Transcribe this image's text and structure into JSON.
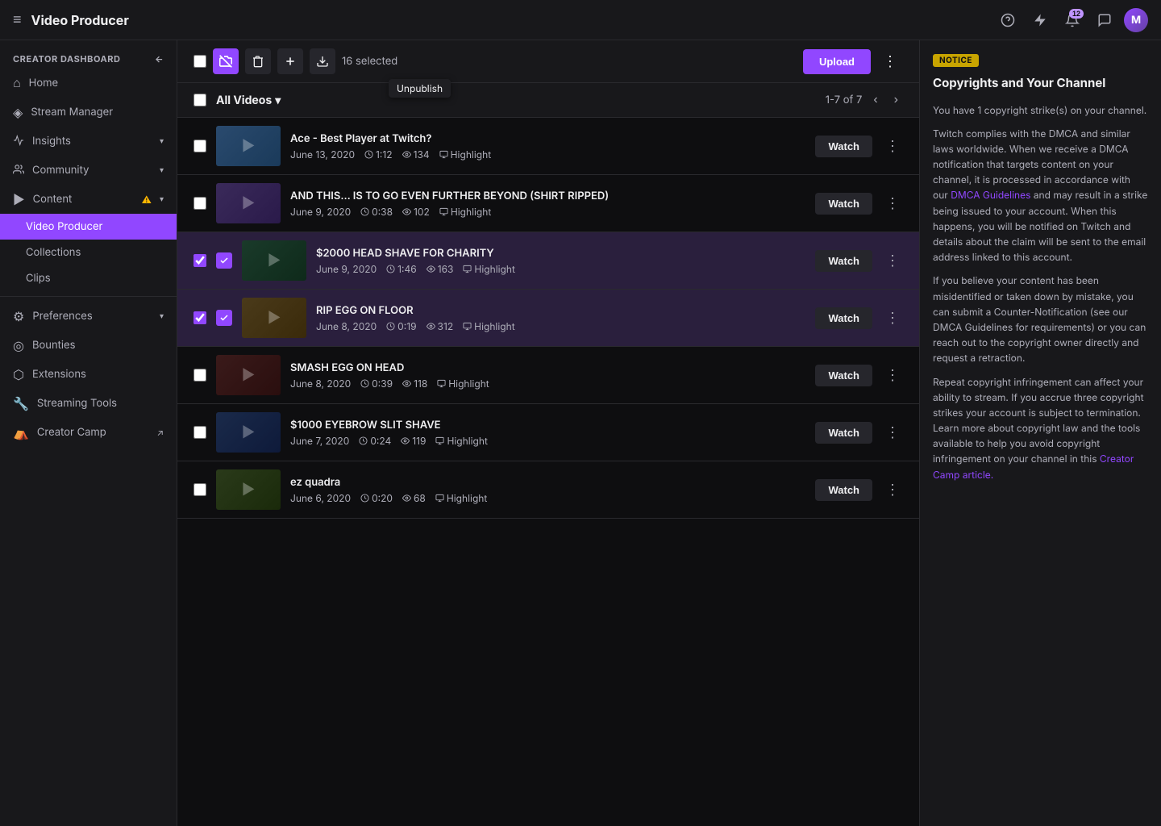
{
  "topNav": {
    "hamburger": "≡",
    "title": "Video Producer",
    "icons": {
      "help": "?",
      "bolt": "⚡",
      "notifications": "🔔",
      "chat": "💬",
      "avatar_label": "M"
    },
    "notification_count": "12"
  },
  "sidebar": {
    "section_label": "CREATOR DASHBOARD",
    "back_icon": "←",
    "items": [
      {
        "id": "home",
        "label": "Home",
        "icon": "⌂"
      },
      {
        "id": "stream-manager",
        "label": "Stream Manager",
        "icon": "◈"
      },
      {
        "id": "insights",
        "label": "Insights",
        "icon": "📈",
        "has_chevron": true
      },
      {
        "id": "community",
        "label": "Community",
        "icon": "👥",
        "has_chevron": true
      },
      {
        "id": "content",
        "label": "Content",
        "icon": "▶",
        "has_warning": true,
        "has_chevron": true
      },
      {
        "id": "video-producer",
        "label": "Video Producer",
        "active": true,
        "sub": true
      },
      {
        "id": "collections",
        "label": "Collections",
        "sub": true
      },
      {
        "id": "clips",
        "label": "Clips",
        "sub": true
      },
      {
        "id": "preferences",
        "label": "Preferences",
        "icon": "⚙",
        "has_chevron": true
      },
      {
        "id": "bounties",
        "label": "Bounties",
        "icon": "◎"
      },
      {
        "id": "extensions",
        "label": "Extensions",
        "icon": "⬡"
      },
      {
        "id": "streaming-tools",
        "label": "Streaming Tools",
        "icon": "🔧"
      },
      {
        "id": "creator-camp",
        "label": "Creator Camp",
        "icon": "⛺",
        "external": true
      }
    ]
  },
  "toolbar": {
    "selected_count": "16 selected",
    "upload_label": "Upload",
    "tooltip_text": "Unpublish",
    "more_icon": "⋮"
  },
  "videoList": {
    "header_label": "All Videos",
    "pagination": "1-7 of 7",
    "videos": [
      {
        "id": 1,
        "title": "Ace - Best Player at Twitch?",
        "date": "June 13, 2020",
        "duration": "1:12",
        "views": "134",
        "type": "Highlight",
        "selected": false,
        "thumb_class": "thumb-1"
      },
      {
        "id": 2,
        "title": "AND THIS... IS TO GO EVEN FURTHER BEYOND (SHIRT RIPPED)",
        "date": "June 9, 2020",
        "duration": "0:38",
        "views": "102",
        "type": "Highlight",
        "selected": false,
        "thumb_class": "thumb-2"
      },
      {
        "id": 3,
        "title": "$2000 HEAD SHAVE FOR CHARITY",
        "date": "June 9, 2020",
        "duration": "1:46",
        "views": "163",
        "type": "Highlight",
        "selected": true,
        "thumb_class": "thumb-3"
      },
      {
        "id": 4,
        "title": "RIP EGG ON FLOOR",
        "date": "June 8, 2020",
        "duration": "0:19",
        "views": "312",
        "type": "Highlight",
        "selected": true,
        "thumb_class": "thumb-4"
      },
      {
        "id": 5,
        "title": "SMASH EGG ON HEAD",
        "date": "June 8, 2020",
        "duration": "0:39",
        "views": "118",
        "type": "Highlight",
        "selected": false,
        "thumb_class": "thumb-5"
      },
      {
        "id": 6,
        "title": "$1000 EYEBROW SLIT SHAVE",
        "date": "June 7, 2020",
        "duration": "0:24",
        "views": "119",
        "type": "Highlight",
        "selected": false,
        "thumb_class": "thumb-6"
      },
      {
        "id": 7,
        "title": "ez quadra",
        "date": "June 6, 2020",
        "duration": "0:20",
        "views": "68",
        "type": "Highlight",
        "selected": false,
        "thumb_class": "thumb-7"
      }
    ],
    "watch_label": "Watch"
  },
  "rightPanel": {
    "badge_label": "NOTICE",
    "title": "Copyrights and Your Channel",
    "paragraphs": [
      "You have 1 copyright strike(s) on your channel.",
      "Twitch complies with the DMCA and similar laws worldwide. When we receive a DMCA notification that targets content on your channel, it is processed in accordance with our DMCA Guidelines and may result in a strike being issued to your account. When this happens, you will be notified on Twitch and details about the claim will be sent to the email address linked to this account.",
      "If you believe your content has been misidentified or taken down by mistake, you can submit a Counter-Notification (see our DMCA Guidelines for requirements) or you can reach out to the copyright owner directly and request a retraction.",
      "Repeat copyright infringement can affect your ability to stream. If you accrue three copyright strikes your account is subject to termination. Learn more about copyright law and the tools available to help you avoid copyright infringement on your channel in this Creator Camp article."
    ],
    "links": {
      "dmca_guidelines": "DMCA Guidelines",
      "creator_camp": "Creator Camp article."
    }
  }
}
